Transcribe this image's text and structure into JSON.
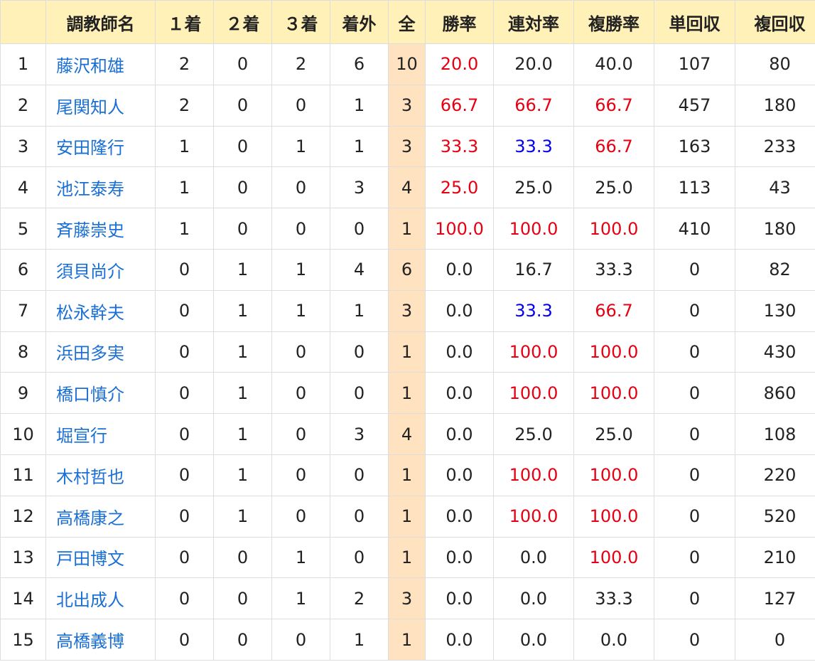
{
  "colors": {
    "header_bg": "#fff1b8",
    "total_bg": "#ffe2c0",
    "link": "#1a6fd4",
    "red": "#e60012",
    "blue": "#0000ee"
  },
  "headers": [
    "",
    "調教師名",
    "１着",
    "２着",
    "３着",
    "着外",
    "全",
    "勝率",
    "連対率",
    "複勝率",
    "単回収",
    "複回収"
  ],
  "rows": [
    {
      "rank": "1",
      "name": "藤沢和雄",
      "first": "2",
      "second": "0",
      "third": "2",
      "out": "6",
      "total": "10",
      "win_rate": {
        "v": "20.0",
        "c": "red"
      },
      "top2_rate": {
        "v": "20.0",
        "c": "black"
      },
      "top3_rate": {
        "v": "40.0",
        "c": "black"
      },
      "win_return": "107",
      "place_return": "80"
    },
    {
      "rank": "2",
      "name": "尾関知人",
      "first": "2",
      "second": "0",
      "third": "0",
      "out": "1",
      "total": "3",
      "win_rate": {
        "v": "66.7",
        "c": "red"
      },
      "top2_rate": {
        "v": "66.7",
        "c": "red"
      },
      "top3_rate": {
        "v": "66.7",
        "c": "red"
      },
      "win_return": "457",
      "place_return": "180"
    },
    {
      "rank": "3",
      "name": "安田隆行",
      "first": "1",
      "second": "0",
      "third": "1",
      "out": "1",
      "total": "3",
      "win_rate": {
        "v": "33.3",
        "c": "red"
      },
      "top2_rate": {
        "v": "33.3",
        "c": "blue"
      },
      "top3_rate": {
        "v": "66.7",
        "c": "red"
      },
      "win_return": "163",
      "place_return": "233"
    },
    {
      "rank": "4",
      "name": "池江泰寿",
      "first": "1",
      "second": "0",
      "third": "0",
      "out": "3",
      "total": "4",
      "win_rate": {
        "v": "25.0",
        "c": "red"
      },
      "top2_rate": {
        "v": "25.0",
        "c": "black"
      },
      "top3_rate": {
        "v": "25.0",
        "c": "black"
      },
      "win_return": "113",
      "place_return": "43"
    },
    {
      "rank": "5",
      "name": "斉藤崇史",
      "first": "1",
      "second": "0",
      "third": "0",
      "out": "0",
      "total": "1",
      "win_rate": {
        "v": "100.0",
        "c": "red"
      },
      "top2_rate": {
        "v": "100.0",
        "c": "red"
      },
      "top3_rate": {
        "v": "100.0",
        "c": "red"
      },
      "win_return": "410",
      "place_return": "180"
    },
    {
      "rank": "6",
      "name": "須貝尚介",
      "first": "0",
      "second": "1",
      "third": "1",
      "out": "4",
      "total": "6",
      "win_rate": {
        "v": "0.0",
        "c": "black"
      },
      "top2_rate": {
        "v": "16.7",
        "c": "black"
      },
      "top3_rate": {
        "v": "33.3",
        "c": "black"
      },
      "win_return": "0",
      "place_return": "82"
    },
    {
      "rank": "7",
      "name": "松永幹夫",
      "first": "0",
      "second": "1",
      "third": "1",
      "out": "1",
      "total": "3",
      "win_rate": {
        "v": "0.0",
        "c": "black"
      },
      "top2_rate": {
        "v": "33.3",
        "c": "blue"
      },
      "top3_rate": {
        "v": "66.7",
        "c": "red"
      },
      "win_return": "0",
      "place_return": "130"
    },
    {
      "rank": "8",
      "name": "浜田多実",
      "first": "0",
      "second": "1",
      "third": "0",
      "out": "0",
      "total": "1",
      "win_rate": {
        "v": "0.0",
        "c": "black"
      },
      "top2_rate": {
        "v": "100.0",
        "c": "red"
      },
      "top3_rate": {
        "v": "100.0",
        "c": "red"
      },
      "win_return": "0",
      "place_return": "430"
    },
    {
      "rank": "9",
      "name": "橋口慎介",
      "first": "0",
      "second": "1",
      "third": "0",
      "out": "0",
      "total": "1",
      "win_rate": {
        "v": "0.0",
        "c": "black"
      },
      "top2_rate": {
        "v": "100.0",
        "c": "red"
      },
      "top3_rate": {
        "v": "100.0",
        "c": "red"
      },
      "win_return": "0",
      "place_return": "860"
    },
    {
      "rank": "10",
      "name": "堀宣行",
      "first": "0",
      "second": "1",
      "third": "0",
      "out": "3",
      "total": "4",
      "win_rate": {
        "v": "0.0",
        "c": "black"
      },
      "top2_rate": {
        "v": "25.0",
        "c": "black"
      },
      "top3_rate": {
        "v": "25.0",
        "c": "black"
      },
      "win_return": "0",
      "place_return": "108"
    },
    {
      "rank": "11",
      "name": "木村哲也",
      "first": "0",
      "second": "1",
      "third": "0",
      "out": "0",
      "total": "1",
      "win_rate": {
        "v": "0.0",
        "c": "black"
      },
      "top2_rate": {
        "v": "100.0",
        "c": "red"
      },
      "top3_rate": {
        "v": "100.0",
        "c": "red"
      },
      "win_return": "0",
      "place_return": "220"
    },
    {
      "rank": "12",
      "name": "高橋康之",
      "first": "0",
      "second": "1",
      "third": "0",
      "out": "0",
      "total": "1",
      "win_rate": {
        "v": "0.0",
        "c": "black"
      },
      "top2_rate": {
        "v": "100.0",
        "c": "red"
      },
      "top3_rate": {
        "v": "100.0",
        "c": "red"
      },
      "win_return": "0",
      "place_return": "520"
    },
    {
      "rank": "13",
      "name": "戸田博文",
      "first": "0",
      "second": "0",
      "third": "1",
      "out": "0",
      "total": "1",
      "win_rate": {
        "v": "0.0",
        "c": "black"
      },
      "top2_rate": {
        "v": "0.0",
        "c": "black"
      },
      "top3_rate": {
        "v": "100.0",
        "c": "red"
      },
      "win_return": "0",
      "place_return": "210"
    },
    {
      "rank": "14",
      "name": "北出成人",
      "first": "0",
      "second": "0",
      "third": "1",
      "out": "2",
      "total": "3",
      "win_rate": {
        "v": "0.0",
        "c": "black"
      },
      "top2_rate": {
        "v": "0.0",
        "c": "black"
      },
      "top3_rate": {
        "v": "33.3",
        "c": "black"
      },
      "win_return": "0",
      "place_return": "127"
    },
    {
      "rank": "15",
      "name": "高橋義博",
      "first": "0",
      "second": "0",
      "third": "0",
      "out": "1",
      "total": "1",
      "win_rate": {
        "v": "0.0",
        "c": "black"
      },
      "top2_rate": {
        "v": "0.0",
        "c": "black"
      },
      "top3_rate": {
        "v": "0.0",
        "c": "black"
      },
      "win_return": "0",
      "place_return": "0"
    }
  ]
}
